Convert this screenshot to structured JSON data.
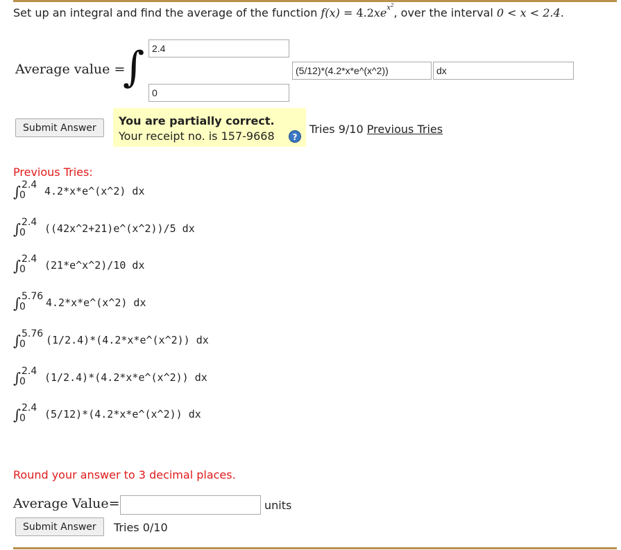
{
  "question": {
    "prefix": "Set up an integral and find the average of the function ",
    "func_lhs": "f(x)",
    "eq": " = 4.2",
    "x": "x",
    "e": "e",
    "exp_x": "x",
    "exp_2": "2",
    "mid": ", over the interval ",
    "interval": "0 < x < 2.4",
    "suffix": "."
  },
  "integral": {
    "label": "Average value =",
    "upper": "2.4",
    "lower": "0",
    "integrand": "(5/12)*(4.2*x*e^(x^2))",
    "dx": "dx"
  },
  "submit1": {
    "label": "Submit Answer"
  },
  "feedback": {
    "main": "You are partially correct.",
    "receipt": "Your receipt no. is 157-9668",
    "help_icon": "?"
  },
  "tries1": {
    "count": "Tries 9/10",
    "link": "Previous Tries"
  },
  "previous": {
    "title": "Previous Tries:",
    "items": [
      {
        "upper": "2.4",
        "lower": "0",
        "expr": "4.2*x*e^(x^2) dx"
      },
      {
        "upper": "2.4",
        "lower": "0",
        "expr": "((42x^2+21)e^(x^2))/5 dx"
      },
      {
        "upper": "2.4",
        "lower": "0",
        "expr": "(21*e^x^2)/10 dx"
      },
      {
        "upper": "5.76",
        "lower": "0",
        "expr": "4.2*x*e^(x^2) dx"
      },
      {
        "upper": "5.76",
        "lower": "0",
        "expr": "(1/2.4)*(4.2*x*e^(x^2)) dx"
      },
      {
        "upper": "2.4",
        "lower": "0",
        "expr": "(1/2.4)*(4.2*x*e^(x^2)) dx"
      },
      {
        "upper": "2.4",
        "lower": "0",
        "expr": "(5/12)*(4.2*x*e^(x^2)) dx"
      }
    ]
  },
  "round_note": "Round your answer to 3 decimal places.",
  "answer": {
    "label": "Average Value=",
    "value": "",
    "units": "units"
  },
  "submit2": {
    "label": "Submit Answer"
  },
  "tries2": "Tries 0/10"
}
